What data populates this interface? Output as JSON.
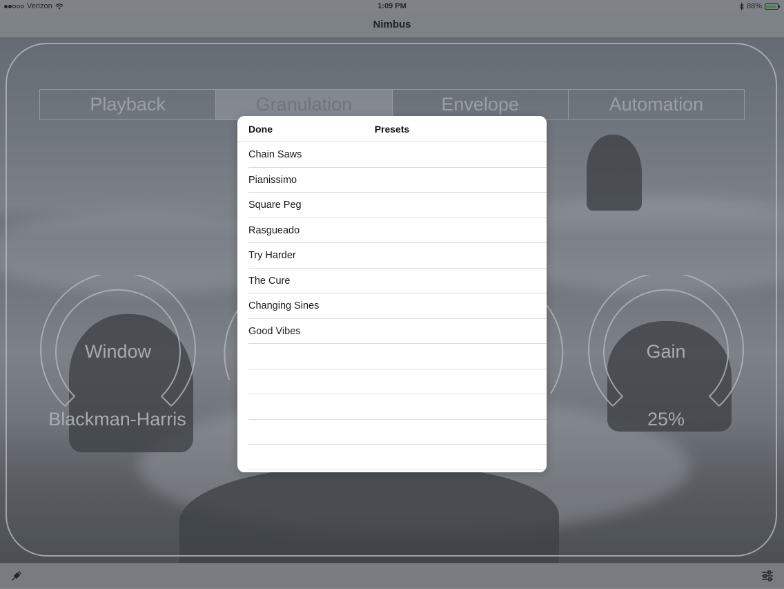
{
  "status_bar": {
    "carrier": "Verizon",
    "time": "1:09 PM",
    "battery_percent": "88%",
    "battery_level": 0.88
  },
  "nav": {
    "title": "Nimbus"
  },
  "tabs": [
    {
      "label": "Playback",
      "active": false
    },
    {
      "label": "Granulation",
      "active": true
    },
    {
      "label": "Envelope",
      "active": false
    },
    {
      "label": "Automation",
      "active": false
    }
  ],
  "knobs": {
    "window": {
      "label": "Window",
      "value": "Blackman-Harris"
    },
    "gain": {
      "label": "Gain",
      "value": "25%"
    }
  },
  "modal": {
    "done_label": "Done",
    "title": "Presets",
    "presets": [
      "Chain Saws",
      "Pianissimo",
      "Square Peg",
      "Rasgueado",
      "Try Harder",
      "The Cure",
      "Changing Sines",
      "Good Vibes"
    ]
  },
  "icons": {
    "toolbar_left": "plug-icon",
    "toolbar_right": "sliders-icon",
    "wifi": "wifi-icon",
    "bluetooth": "bluetooth-icon"
  }
}
